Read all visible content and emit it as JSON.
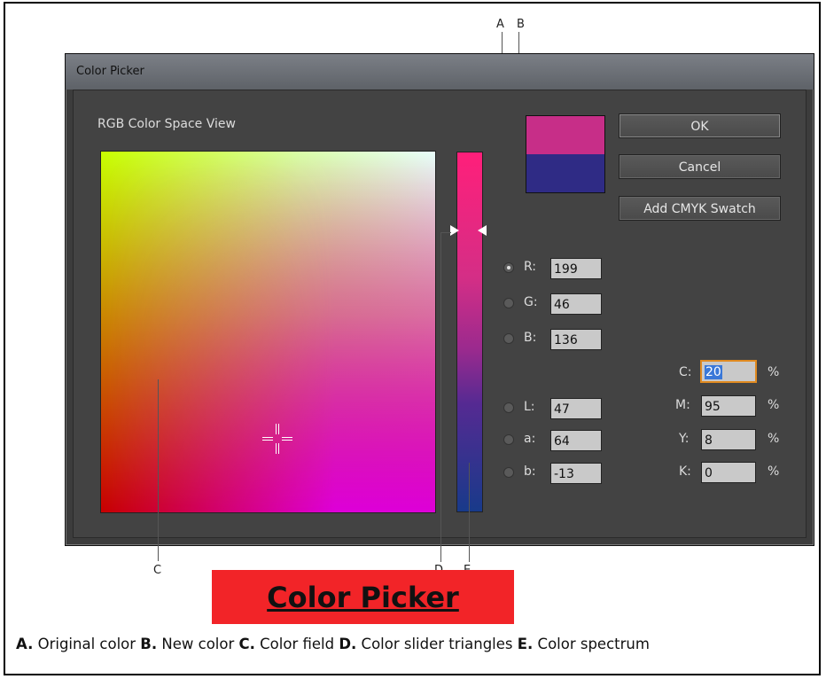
{
  "window": {
    "title": "Color Picker"
  },
  "view_label": "RGB Color Space View",
  "colors": {
    "new": "#c72e88",
    "original": "#2f2b85",
    "dialog_bg": "#434343",
    "banner_bg": "#f22428",
    "focus_ring": "#e08a20"
  },
  "buttons": {
    "ok": "OK",
    "cancel": "Cancel",
    "add_swatch": "Add CMYK Swatch"
  },
  "rgb": [
    {
      "label": "R:",
      "value": "199",
      "selected": true
    },
    {
      "label": "G:",
      "value": "46",
      "selected": false
    },
    {
      "label": "B:",
      "value": "136",
      "selected": false
    }
  ],
  "lab": [
    {
      "label": "L:",
      "value": "47"
    },
    {
      "label": "a:",
      "value": "64"
    },
    {
      "label": "b:",
      "value": "-13"
    }
  ],
  "cmyk": [
    {
      "label": "C:",
      "value": "20",
      "unit": "%"
    },
    {
      "label": "M:",
      "value": "95",
      "unit": "%"
    },
    {
      "label": "Y:",
      "value": "8",
      "unit": "%"
    },
    {
      "label": "K:",
      "value": "0",
      "unit": "%"
    }
  ],
  "callouts": {
    "a": "A",
    "b": "B",
    "c": "C",
    "d": "D",
    "e": "E"
  },
  "banner_text": "Color Picker",
  "caption": [
    {
      "key": "A.",
      "text": " Original color "
    },
    {
      "key": "B.",
      "text": " New color "
    },
    {
      "key": "C.",
      "text": " Color field "
    },
    {
      "key": "D.",
      "text": " Color slider triangles "
    },
    {
      "key": "E.",
      "text": " Color spectrum"
    }
  ]
}
